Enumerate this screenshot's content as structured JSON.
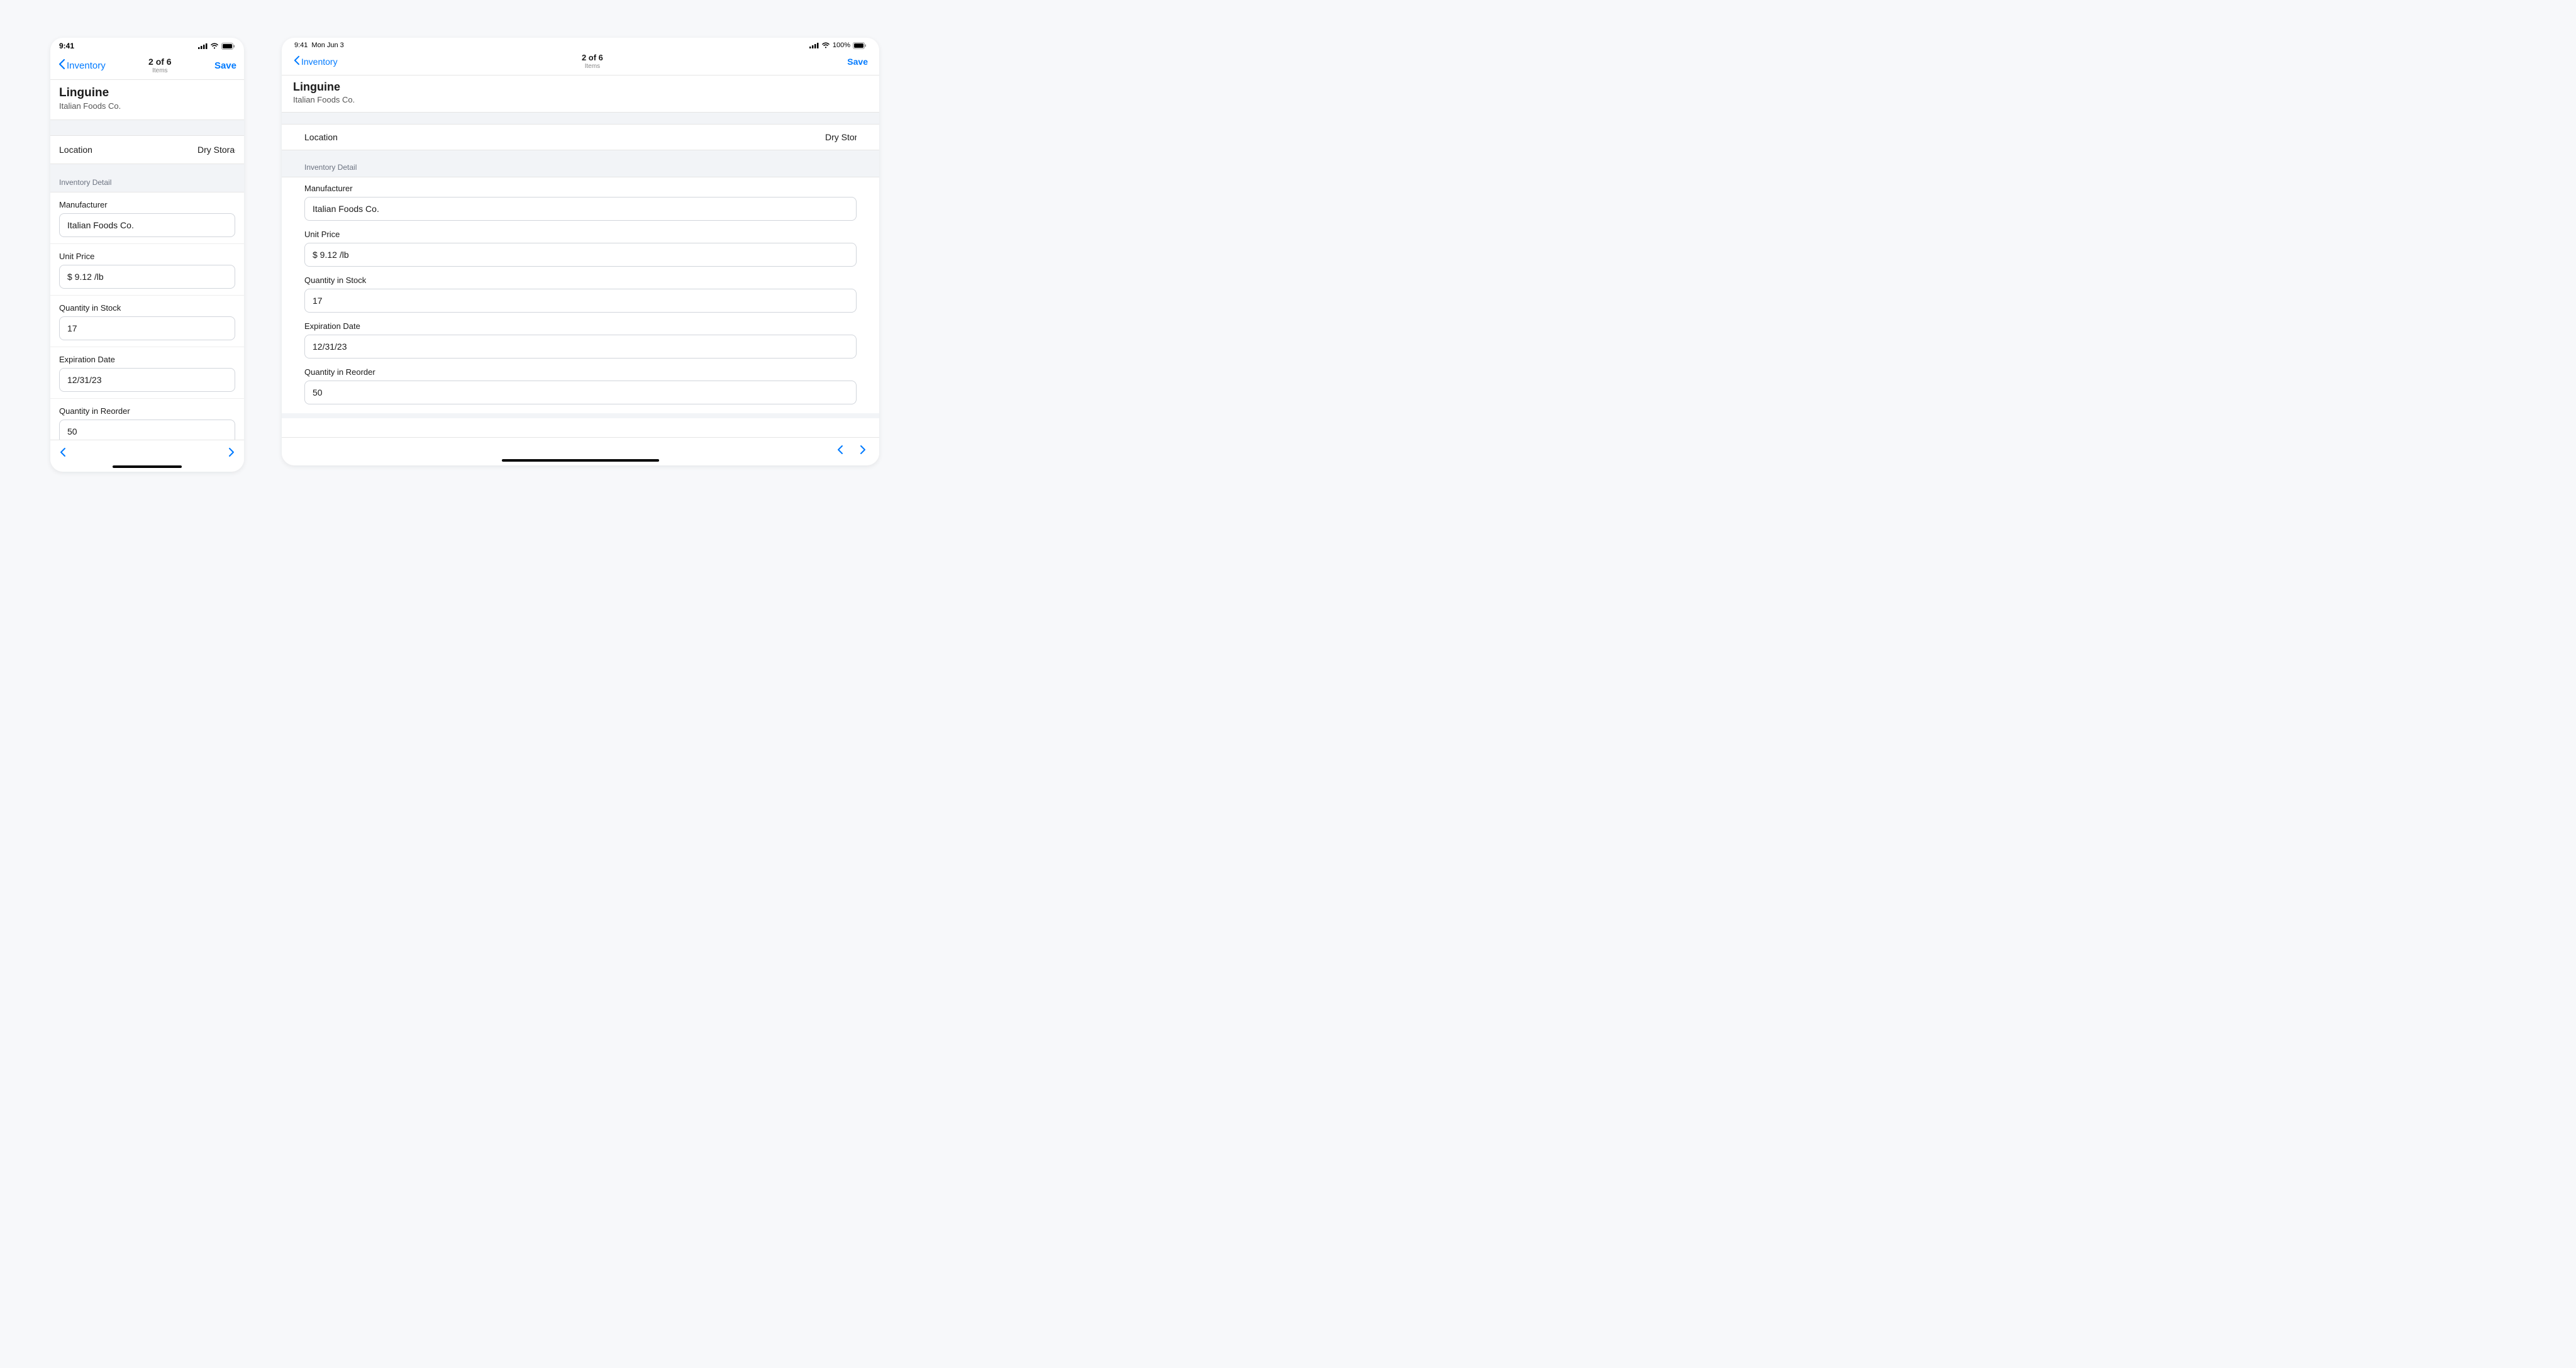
{
  "status": {
    "time": "9:41",
    "date": "Mon Jun 3",
    "battery_pct": "100%"
  },
  "nav": {
    "back_label": "Inventory",
    "title": "2 of 6",
    "subtitle": "Items",
    "save_label": "Save"
  },
  "item": {
    "title": "Linguine",
    "subtitle": "Italian Foods Co."
  },
  "location": {
    "label": "Location",
    "value": "Dry Storage"
  },
  "section": {
    "inventory_detail": "Inventory Detail"
  },
  "fields": {
    "manufacturer": {
      "label": "Manufacturer",
      "value": "Italian Foods Co."
    },
    "unit_price": {
      "label": "Unit Price",
      "value": "$ 9.12 /lb"
    },
    "quantity_stock": {
      "label": "Quantity in Stock",
      "value": "17"
    },
    "expiration_date": {
      "label": "Expiration Date",
      "value": "12/31/23"
    },
    "quantity_reorder": {
      "label": "Quantity in Reorder",
      "value": "50"
    }
  }
}
